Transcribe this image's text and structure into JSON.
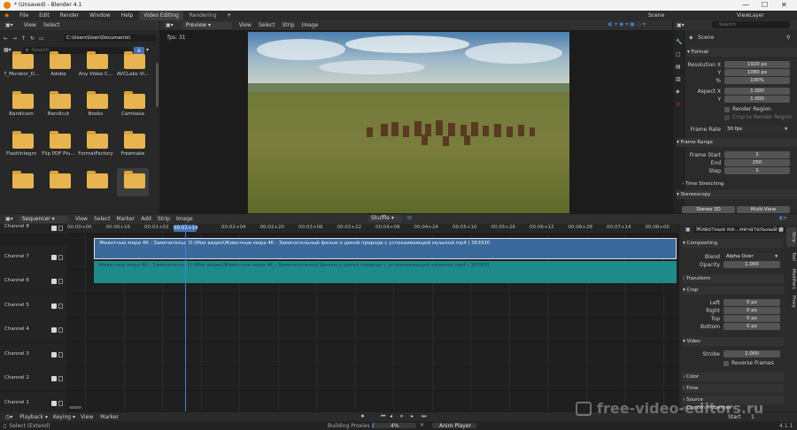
{
  "window": {
    "title": "* (Unsaved) - Blender 4.1"
  },
  "menubar": {
    "items": [
      "File",
      "Edit",
      "Render",
      "Window",
      "Help"
    ],
    "tabs": [
      "Video Editing",
      "Rendering"
    ],
    "add_tab": "+",
    "scene": "Scene",
    "view_layer": "ViewLayer"
  },
  "file_browser": {
    "menus": [
      "View",
      "Select"
    ],
    "path": "C:\\Users\\User\\Documents\\",
    "search_placeholder": "Search",
    "folders": [
      "7_Murator_D...",
      "Adobe",
      "Any Video C...",
      "AVCLabs Vi...",
      "Bandicam",
      "Bandicut",
      "Books",
      "Camtasia",
      "FlashIntegro",
      "Flip PDF Plu...",
      "FormatFactory",
      "Freemake",
      "",
      "",
      "",
      ""
    ]
  },
  "preview": {
    "mode": "Preview",
    "menus": [
      "View",
      "Select",
      "Strip",
      "Image"
    ],
    "fps": "fps: 31"
  },
  "properties_top": {
    "search_placeholder": "Search",
    "scene_label": "Scene",
    "format_section": "Format",
    "resolution_x_label": "Resolution X",
    "resolution_x": "1920 px",
    "y_label": "Y",
    "resolution_y": "1080 px",
    "percent_label": "%",
    "percent": "100%",
    "aspect_x_label": "Aspect X",
    "aspect_x": "1.000",
    "aspect_y": "1.000",
    "render_region": "Render Region",
    "crop_region": "Crop to Render Region",
    "frame_rate_label": "Frame Rate",
    "frame_rate": "30 fps",
    "frame_range_section": "Frame Range",
    "frame_start_label": "Frame Start",
    "frame_start": "1",
    "end_label": "End",
    "end": "250",
    "step_label": "Step",
    "step": "1",
    "time_stretching": "Time Stretching",
    "stereoscopy": "Stereoscopy",
    "stereo_tabs": [
      "Stereo 3D",
      "Multi-View"
    ]
  },
  "sequencer": {
    "mode": "Sequencer",
    "menus": [
      "View",
      "Select",
      "Marker",
      "Add",
      "Strip",
      "Image"
    ],
    "snap": "Shuffle",
    "current_frame": "00:01+14",
    "ticks": [
      "00:00+00",
      "00:00+16",
      "00:01+02",
      "00:01+18",
      "00:02+04",
      "00:02+20",
      "00:03+06",
      "00:03+22",
      "00:04+08",
      "00:04+24",
      "00:05+10",
      "00:05+26",
      "00:06+12",
      "00:06+28",
      "00:07+14",
      "00:08+00"
    ],
    "channels": [
      "Channel 8",
      "Channel 7",
      "Channel 6",
      "Channel 5",
      "Channel 4",
      "Channel 3",
      "Channel 2",
      "Channel 1"
    ],
    "strip_video_left": "Животные мира 4K - Замечательный ф",
    "strip_video_right": "D:\\Мои видео\\Животные мира 4K - Замечательный фильм о дикой природе с успокаивающей музыкой.mp4 | 363930",
    "strip_audio_left": "Животные мира 4K - Замечательный фил",
    "strip_audio_right": "D:\\Мои видео\\Животные мира 4K - Замечательный фильм о дикой природе с успокаивающей музыкой.mp4 | 363930"
  },
  "strip_panel": {
    "name": "Животные ми...мечательный ф",
    "compositing": "Compositing",
    "blend_label": "Blend",
    "blend": "Alpha Over",
    "opacity_label": "Opacity",
    "opacity": "1.000",
    "transform": "Transform",
    "crop": "Crop",
    "left_label": "Left",
    "left": "0 px",
    "right_label": "Right",
    "right": "0 px",
    "top_label": "Top",
    "top": "0 px",
    "bottom_label": "Bottom",
    "bottom": "0 px",
    "video": "Video",
    "strobe_label": "Strobe",
    "strobe": "1.000",
    "reverse_frames": "Reverse Frames",
    "color": "Color",
    "time": "Time",
    "source": "Source",
    "custom_properties": "Custom Properties",
    "side_tabs": [
      "Strip",
      "Tool",
      "Modifiers",
      "Proxy"
    ]
  },
  "timeline_footer": {
    "menus": [
      "Playback",
      "Keying",
      "View",
      "Marker"
    ],
    "start_label": "Start",
    "start": "1"
  },
  "statusbar": {
    "select": "Select (Extend)",
    "building": "Building Proxies",
    "progress": "4%",
    "anim_player": "Anim Player",
    "version": "4.1.1"
  },
  "watermark": "free-video-editors.ru",
  "colors": {
    "accent": "#4772b3",
    "video_strip": "#3a6a9c",
    "audio_strip": "#1f8a8a",
    "playhead": "#4a7fd6",
    "folder": "#e8b450"
  }
}
